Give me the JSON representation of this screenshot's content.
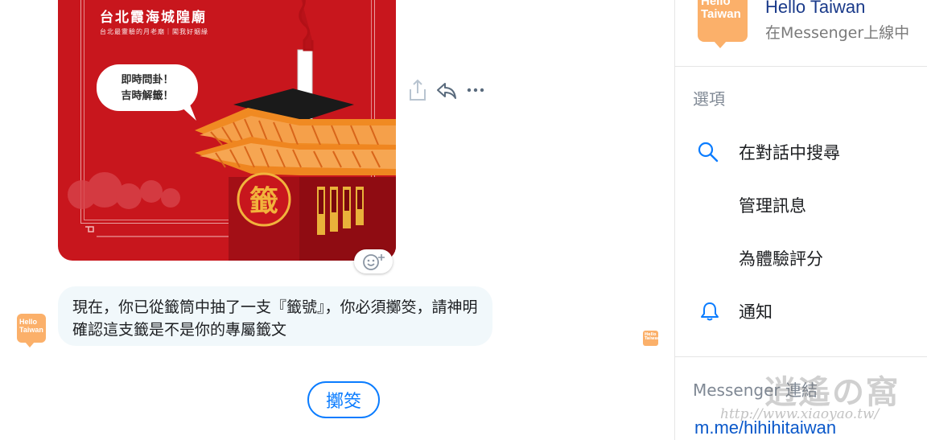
{
  "card": {
    "title": "台北霞海城隍廟",
    "subtitle": "台北最靈驗的月老廟｜闖我好姻緣",
    "speech_line1": "即時問卦！",
    "speech_line2": "吉時解籤！",
    "seal_char": "籤"
  },
  "message": {
    "sender_avatar_text": "Hello Taiwan",
    "text": "現在，你已從籤筒中抽了一支『籤號』，你必須擲筊，請神明確認這支籤是不是你的專屬籤文"
  },
  "quick_reply": {
    "label": "擲筊"
  },
  "seen_avatar_text": "Hello Taiwan",
  "right_pane": {
    "avatar_text": "Hello Taiwan",
    "name": "Hello Taiwan",
    "status": "在Messenger上線中",
    "options_heading": "選項",
    "items": [
      {
        "label": "在對話中搜尋",
        "icon": "search-icon"
      },
      {
        "label": "管理訊息",
        "icon": ""
      },
      {
        "label": "為體驗評分",
        "icon": ""
      },
      {
        "label": "通知",
        "icon": "bell-icon"
      }
    ],
    "links_heading": "Messenger 連結",
    "link": "m.me/hihihitaiwan"
  },
  "watermark": {
    "logo": "逍遙の窩",
    "url": "http://www.xiaoyao.tw/"
  },
  "colors": {
    "accent": "#0a7cff",
    "brand": "#fbb06a",
    "card_red": "#c8161d",
    "bubble": "#f1f8fb"
  }
}
